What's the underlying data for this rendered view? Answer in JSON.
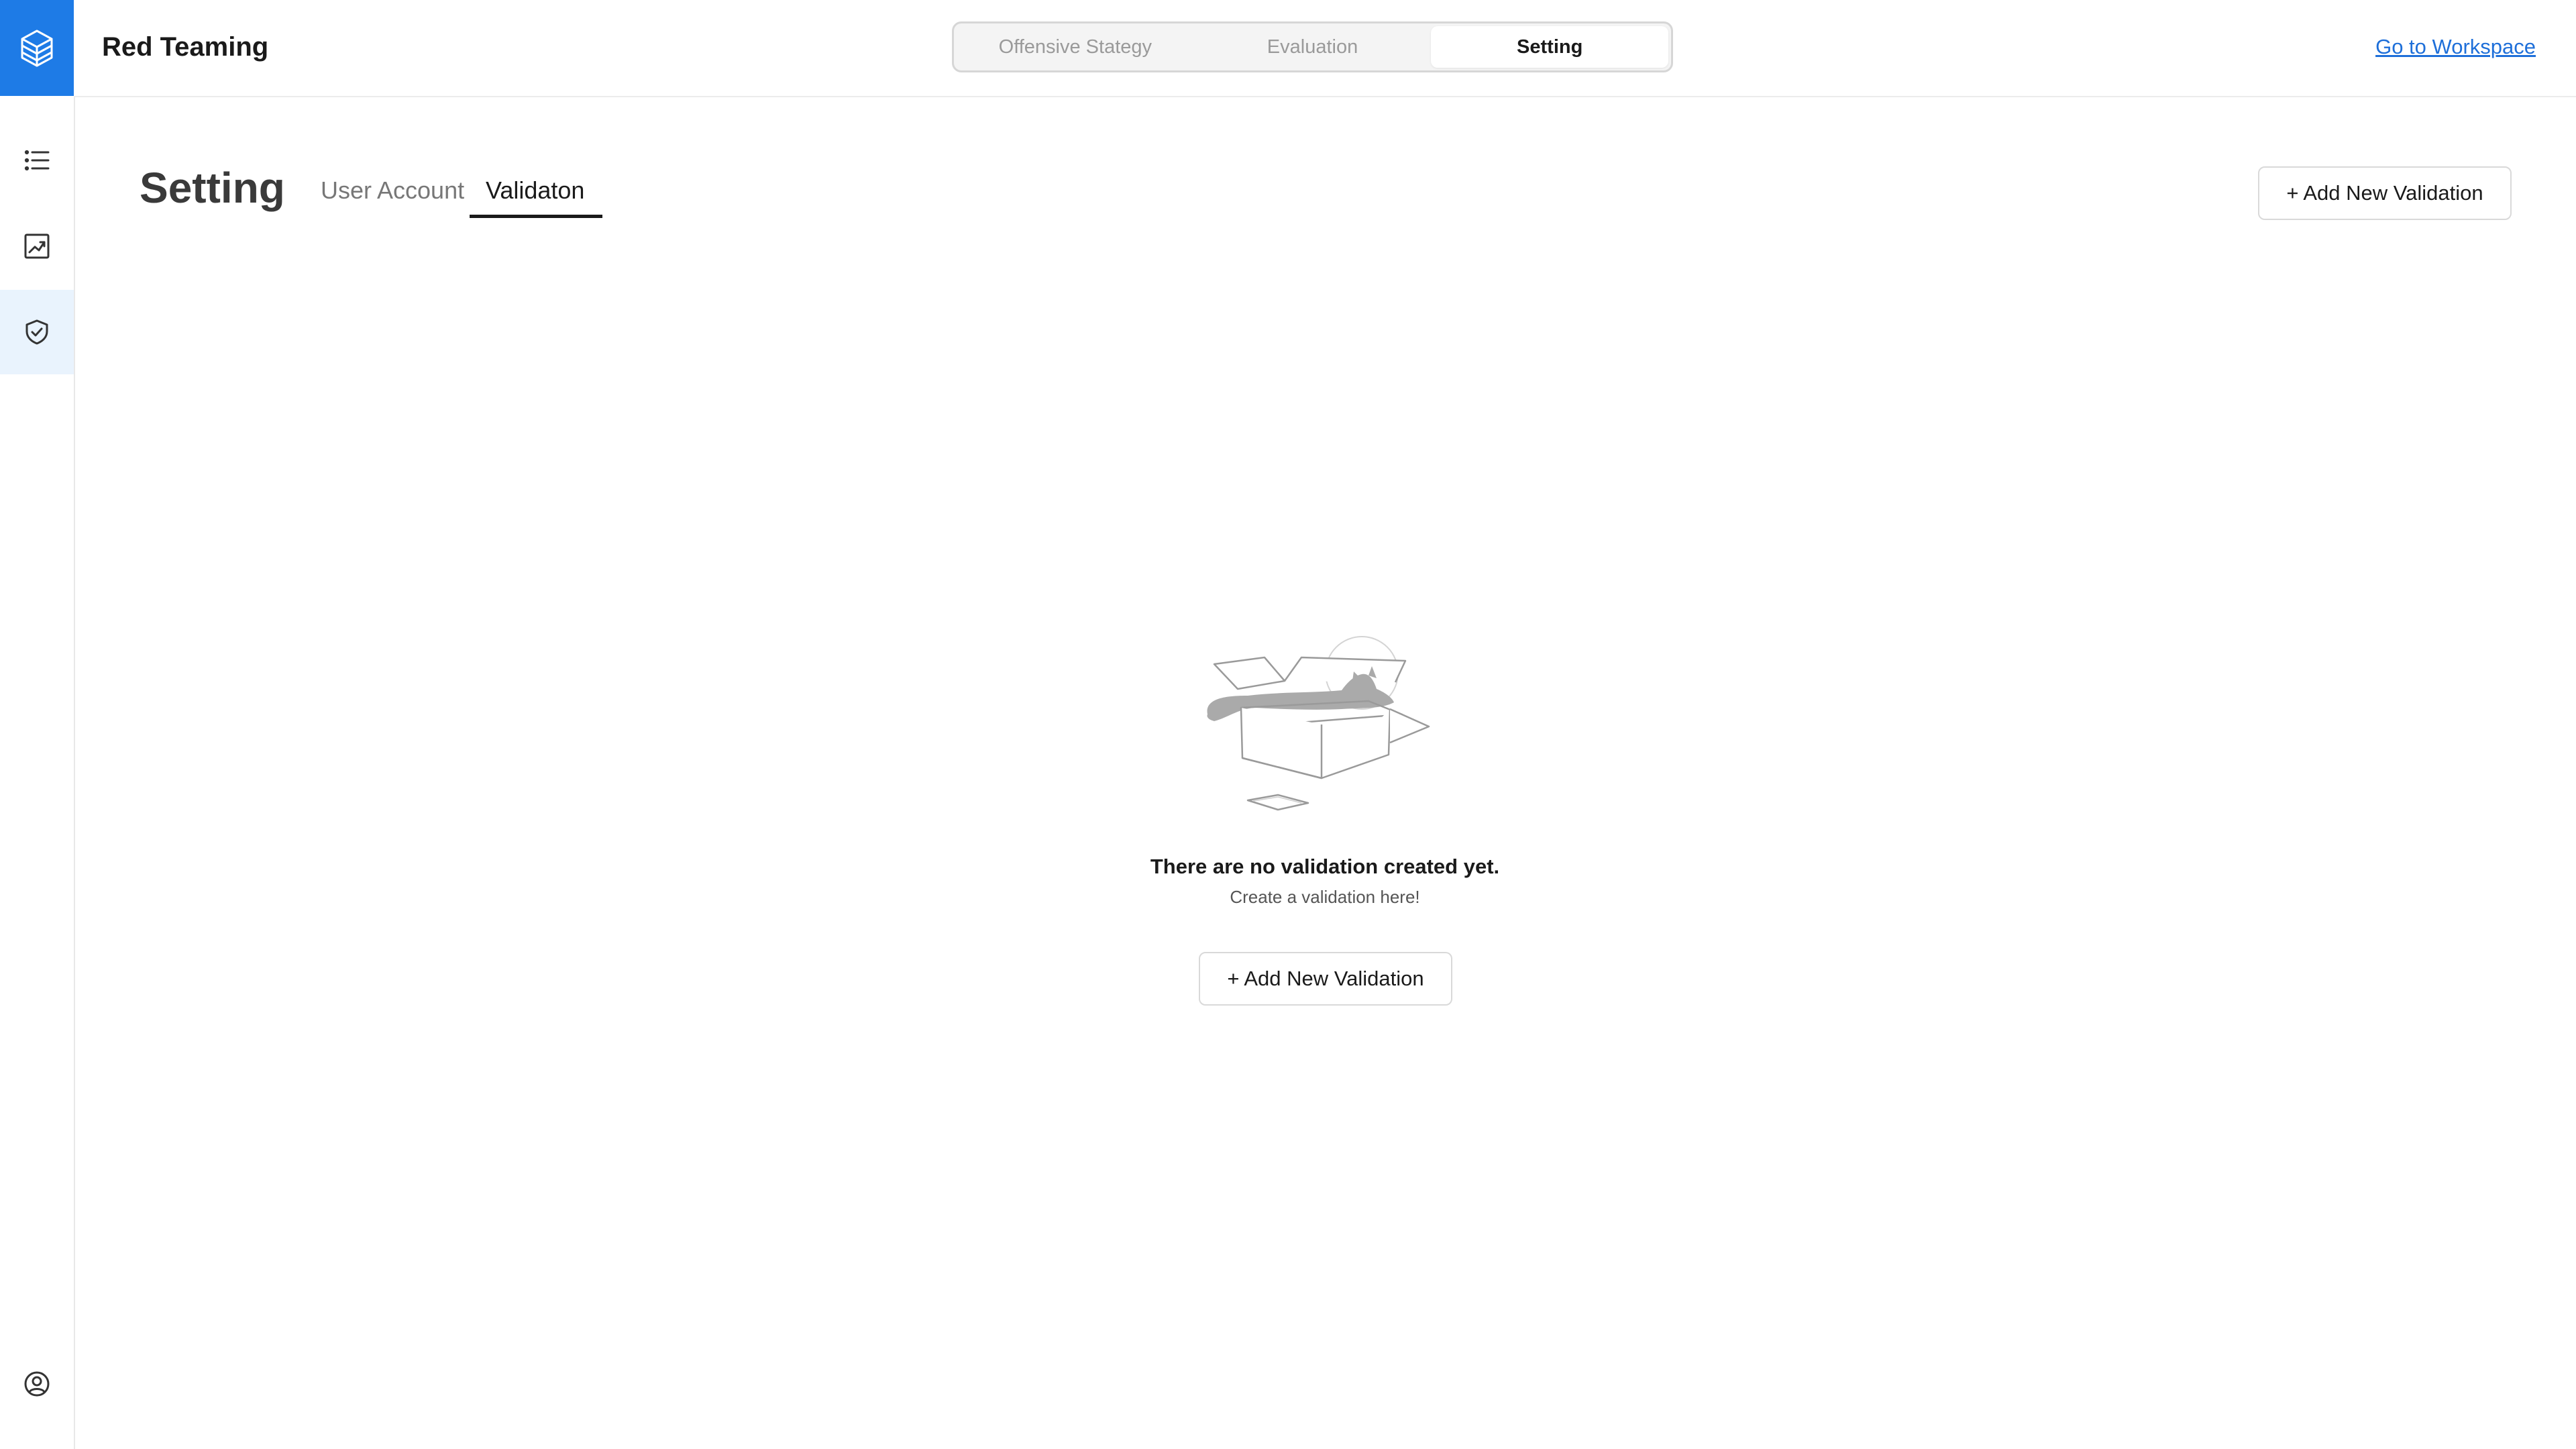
{
  "app": {
    "title": "Red Teaming"
  },
  "header": {
    "tabs": [
      {
        "label": "Offensive Stategy",
        "active": false
      },
      {
        "label": "Evaluation",
        "active": false
      },
      {
        "label": "Setting",
        "active": true
      }
    ],
    "workspace_link": "Go to Workspace"
  },
  "sidebar": {
    "logo_icon": "layers-logo-icon",
    "items": [
      {
        "icon": "list-icon",
        "active": false
      },
      {
        "icon": "chart-icon",
        "active": false
      },
      {
        "icon": "shield-check-icon",
        "active": true
      }
    ],
    "bottom_icon": "user-circle-icon"
  },
  "page": {
    "title": "Setting",
    "subtabs": [
      {
        "label": "User Account",
        "active": false
      },
      {
        "label": "Validaton",
        "active": true
      }
    ],
    "add_button": "+ Add New Validation"
  },
  "empty_state": {
    "title": "There are no validation created yet.",
    "subtitle": "Create a validation here!",
    "button": "+ Add New Validation"
  },
  "colors": {
    "brand": "#1e7be6",
    "active_sidebar_bg": "#e9f3fd",
    "link": "#1e6fd9"
  }
}
